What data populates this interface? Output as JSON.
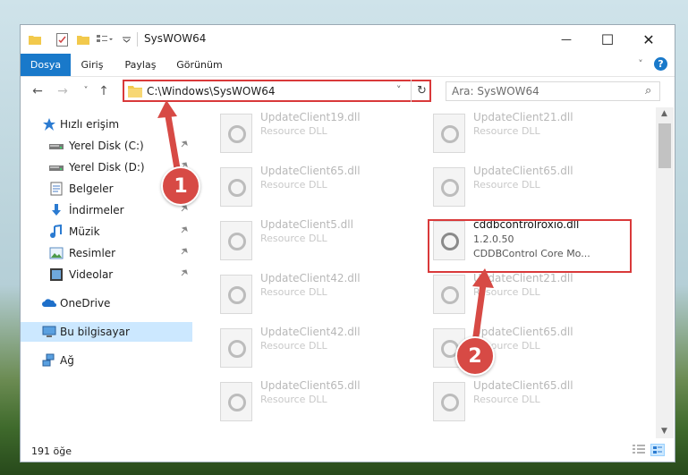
{
  "window": {
    "title": "SysWOW64",
    "minimize_glyph": "—",
    "maximize_glyph": "☐",
    "close_glyph": "✕"
  },
  "ribbon": {
    "tabs": [
      {
        "label": "Dosya",
        "active": true
      },
      {
        "label": "Giriş"
      },
      {
        "label": "Paylaş"
      },
      {
        "label": "Görünüm"
      }
    ],
    "help_glyph": "?",
    "expand_glyph": "˅"
  },
  "nav": {
    "back_glyph": "←",
    "forward_glyph": "→",
    "recent_glyph": "˅",
    "up_glyph": "↑",
    "address": "C:\\Windows\\SysWOW64",
    "address_dropdown_glyph": "˅",
    "refresh_glyph": "↻",
    "search_placeholder": "Ara: SysWOW64",
    "search_glyph": "⌕"
  },
  "sidebar": {
    "items": [
      {
        "label": "Hızlı erişim",
        "icon": "star-icon",
        "pinned": false
      },
      {
        "label": "Yerel Disk (C:)",
        "icon": "drive-icon",
        "pinned": true
      },
      {
        "label": "Yerel Disk (D:)",
        "icon": "drive-icon",
        "pinned": true
      },
      {
        "label": "Belgeler",
        "icon": "documents-icon",
        "pinned": true
      },
      {
        "label": "İndirmeler",
        "icon": "download-icon",
        "pinned": true
      },
      {
        "label": "Müzik",
        "icon": "music-icon",
        "pinned": true
      },
      {
        "label": "Resimler",
        "icon": "pictures-icon",
        "pinned": true
      },
      {
        "label": "Videolar",
        "icon": "videos-icon",
        "pinned": true
      },
      {
        "label": "OneDrive",
        "icon": "cloud-icon",
        "pinned": false
      },
      {
        "label": "Bu bilgisayar",
        "icon": "computer-icon",
        "pinned": false,
        "selected": true
      },
      {
        "label": "Ağ",
        "icon": "network-icon",
        "pinned": false
      }
    ],
    "pin_glyph": "→"
  },
  "files": [
    {
      "name": "UpdateClient19.dll",
      "desc": "Resource DLL"
    },
    {
      "name": "UpdateClient21.dll",
      "desc": "Resource DLL"
    },
    {
      "name": "UpdateClient65.dll",
      "desc": "Resource DLL"
    },
    {
      "name": "UpdateClient65.dll",
      "desc": "Resource DLL"
    },
    {
      "name": "UpdateClient5.dll",
      "desc": "Resource DLL"
    },
    {
      "name": "cddbcontrolroxio.dll",
      "version": "1.2.0.50",
      "desc": "CDDBControl Core Mo...",
      "highlighted": true
    },
    {
      "name": "UpdateClient42.dll",
      "desc": "Resource DLL"
    },
    {
      "name": "UpdateClient21.dll",
      "desc": "Resource DLL"
    },
    {
      "name": "UpdateClient42.dll",
      "desc": "Resource DLL"
    },
    {
      "name": "UpdateClient65.dll",
      "desc": "Resource DLL"
    },
    {
      "name": "UpdateClient65.dll",
      "desc": "Resource DLL"
    },
    {
      "name": "UpdateClient65.dll",
      "desc": "Resource DLL"
    }
  ],
  "status": {
    "count": "191 öğe"
  },
  "annotations": {
    "step1": "1",
    "step2": "2",
    "color": "#d9393a"
  }
}
